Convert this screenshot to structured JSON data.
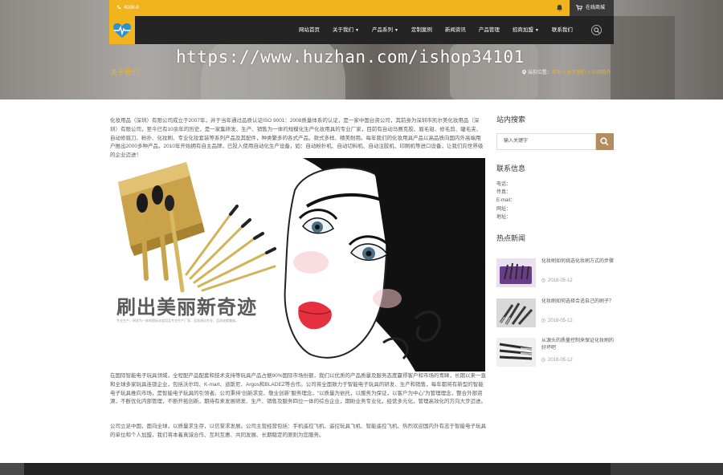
{
  "topbar": {
    "phone": "4008-8",
    "cart_label": "在线商城",
    "colors": {
      "accent": "#f2b41c",
      "dark": "#242424"
    }
  },
  "nav": {
    "items": [
      {
        "label": "网站首页",
        "has_caret": false
      },
      {
        "label": "关于我们",
        "has_caret": true
      },
      {
        "label": "产品系列",
        "has_caret": true
      },
      {
        "label": "定制案例",
        "has_caret": false
      },
      {
        "label": "新闻资讯",
        "has_caret": false
      },
      {
        "label": "产品管理",
        "has_caret": false
      },
      {
        "label": "招商加盟",
        "has_caret": true
      },
      {
        "label": "联系我们",
        "has_caret": false
      }
    ]
  },
  "watermark": "https://www.huzhan.com/ishop34101",
  "page_title": "关于我们",
  "breadcrumb": {
    "prefix": "当前位置：",
    "path": "首页 > 关于我们 > 公司简介"
  },
  "article": {
    "intro": "化妆用品（深圳）有限公司成立于2007年，并于当年通过品质认证ISO 9001：2008质量体系的认证，是一家中国台资公司，其前身为深圳市凯尔美化妆用品（深圳）有限公司，至今已有10余年的历史，是一家集研发、生产、销售为一体的规模化生产化妆用具的专业厂家，目前有自动马赛克胶、眉毛钳、修毛剪、睫毛夹、自动修眉刀、粉扑、化妆刷、专业化妆套装等系列产品及其配件，种类繁多的各式产品，款式多样、精美耐用。每年我们的化妆用具产品以高品质向国内外高端用户推出2000多种产品，2010年开始拥有自主品牌，已投入使用自动化生产设备，如：自动粉扑机、自动切料机、自动注胶机、印刷机等进口设备，让我们向世界级的企业迈进！",
    "slogan": "刷出美丽新奇迹",
    "fine_print": "专业生产，研发为一体的国际化妆用品专业生产厂家，品质源自专业，品质成就美丽。",
    "para2": "在国际智能电子玩具领域，全程配产品配套和技术支持等玩具产品占据90%国际市场份额，我们以优质的产品质量及服务态度赢得客户和市场的青睐，长期以来一直和全球多家玩具连锁企业，包括沃尔玛、K-mart、迪斯尼、Argos和BLADEZ等合作。公司将全面致力于智能电子玩具的研发、生产和销售，每年都将有新型的智能电子玩具推向市场，是智能电子玩具的引领者。公司秉持“创新求变、敬业创新”服务理念，“以质量为依托，以服务为保证，以客户为中心”为管理理念，整合外部资源，不断优化内部管理，不断开拓创新，期待有来发展研发、生产、销售及服务四位一体的综合企业，期盼业务专业化，经营多元化，管理高效化的方向大步迈进。",
    "para3": "公司立足中国，面向全球，以质量求生存，以信誉求发展。公司主营经营包括：手机遥控飞机、遥控玩具飞机、智能遥控飞机、热烈欢迎国内外有志于智能电子玩具的单位和个人加盟，我们将本着真诚合作、互利互惠、共同发展、长期稳定的原则为您服务。"
  },
  "sidebar": {
    "search_title": "站内搜索",
    "search_placeholder": "输入关键字",
    "contact_title": "联系信息",
    "contact": {
      "tel": "电话：",
      "fax": "传真：",
      "email": "E-mail：",
      "url": "网址：",
      "address": "地址："
    },
    "hot_title": "热点新闻",
    "news": [
      {
        "title": "化妆刷如何挑选化妆刷方式的步骤",
        "date": "2018-05-12"
      },
      {
        "title": "化妆刷如何选择合适自己的刷子？",
        "date": "2018-05-12"
      },
      {
        "title": "从源头的质量控制来保证化妆刷的好坏吧",
        "date": "2018-05-12"
      }
    ]
  }
}
